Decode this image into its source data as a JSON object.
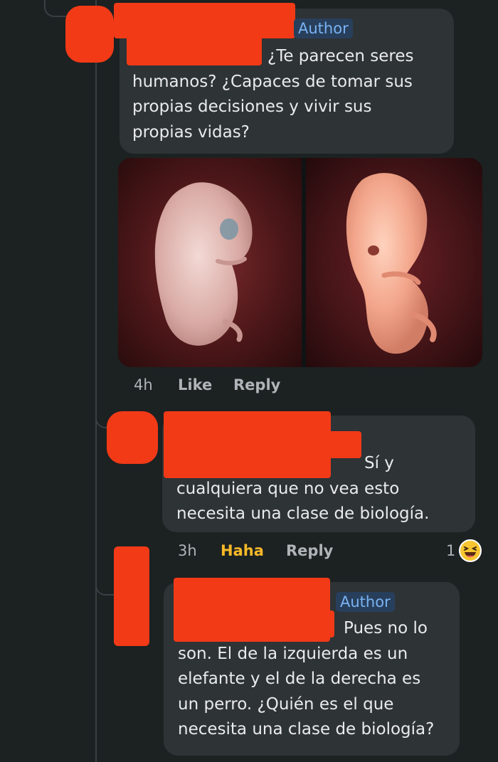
{
  "comment_1": {
    "badge": "Author",
    "text": "¿Te parecen seres\nhumanos? ¿Capaces de tomar sus\npropias decisiones y vivir sus\npropias vidas?",
    "timestamp": "4h",
    "like_label": "Like",
    "reply_label": "Reply"
  },
  "comment_2": {
    "text": "Sí y\ncualquiera que no vea esto\nnecesita una clase de biología.",
    "timestamp": "3h",
    "reaction_label": "Haha",
    "reply_label": "Reply",
    "reaction_count": "1",
    "reaction_icon": "laughing-face-emoji"
  },
  "comment_3": {
    "badge": "Author",
    "text": "Pues no lo\nson. El de la izquierda es un\nelefante y el de la derecha es\nun perro. ¿Quién es el que\nnecesita una clase de biología?"
  },
  "colors": {
    "background": "#1c2122",
    "bubble": "#2e3336",
    "redaction": "#f23a17",
    "author_badge_bg": "#283f5c",
    "author_badge_text": "#79b3f3",
    "haha_active": "#f7b928",
    "meta_text": "#b0b3b8"
  }
}
